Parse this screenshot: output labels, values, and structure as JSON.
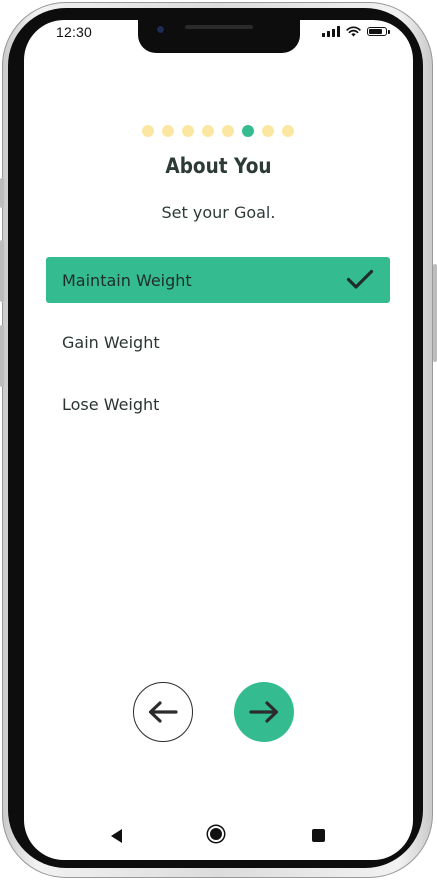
{
  "status_bar": {
    "time": "12:30"
  },
  "progress": {
    "total_steps": 8,
    "current_step": 6
  },
  "header": {
    "title": "About You",
    "subtitle": "Set your Goal."
  },
  "options": [
    {
      "label": "Maintain Weight",
      "selected": true
    },
    {
      "label": "Gain Weight",
      "selected": false
    },
    {
      "label": "Lose Weight",
      "selected": false
    }
  ],
  "navigation": {
    "back_icon": "arrow-left-icon",
    "next_icon": "arrow-right-icon"
  },
  "system_nav": {
    "icons": [
      "back-triangle-icon",
      "home-circle-icon",
      "recents-square-icon"
    ]
  },
  "colors": {
    "accent": "#34bc90",
    "dot_inactive": "#fbe7a1",
    "text_dark": "#2d3b36"
  }
}
